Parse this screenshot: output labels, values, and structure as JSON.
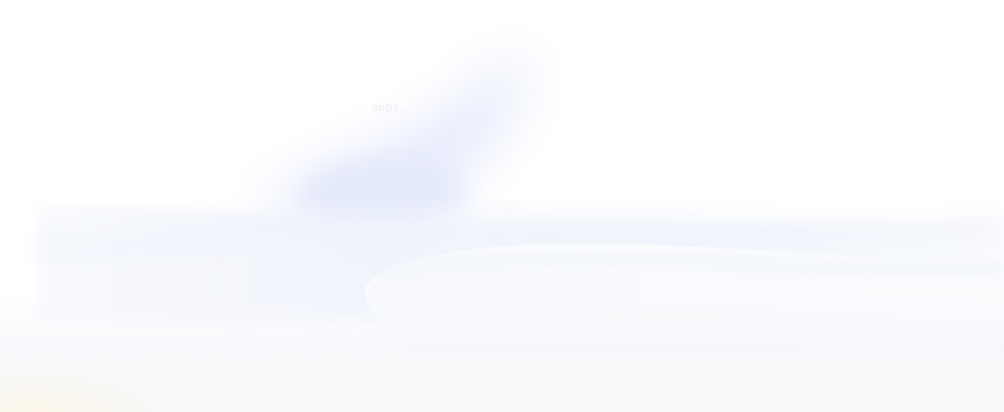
{
  "hero": {
    "headline_fragment": "apps,",
    "subtext_fragment": ""
  },
  "colors": {
    "background": "#ffffff",
    "accent_haze": "#dfe6fb",
    "wave_light": "#f3f6fc",
    "bottom_tint": "#f7f8fa"
  }
}
